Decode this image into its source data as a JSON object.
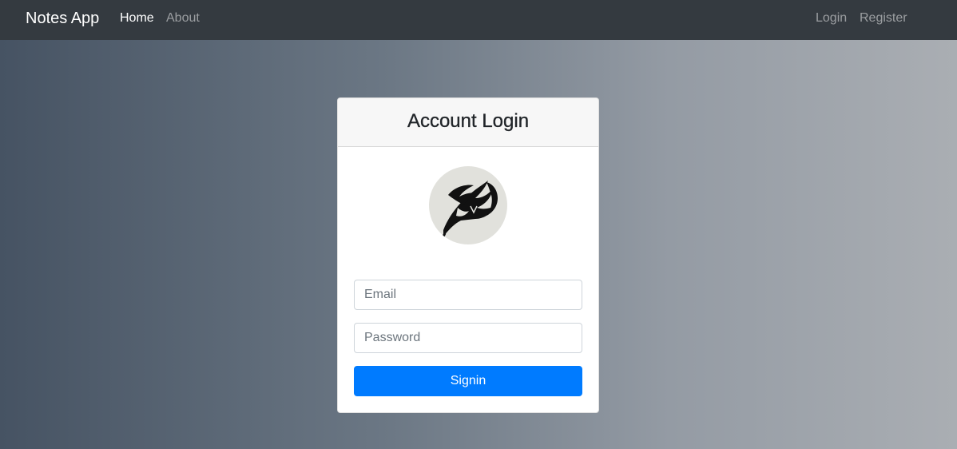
{
  "navbar": {
    "brand": "Notes App",
    "left_links": [
      {
        "label": "Home",
        "active": true
      },
      {
        "label": "About",
        "active": false
      }
    ],
    "right_links": [
      {
        "label": "Login"
      },
      {
        "label": "Register"
      }
    ],
    "background_color": "#343a40"
  },
  "card": {
    "title": "Account Login",
    "avatar_icon": "fairy-tail-emblem-icon",
    "email": {
      "value": "",
      "placeholder": "Email"
    },
    "password": {
      "value": "",
      "placeholder": "Password"
    },
    "submit_label": "Signin",
    "submit_color": "#007bff"
  }
}
